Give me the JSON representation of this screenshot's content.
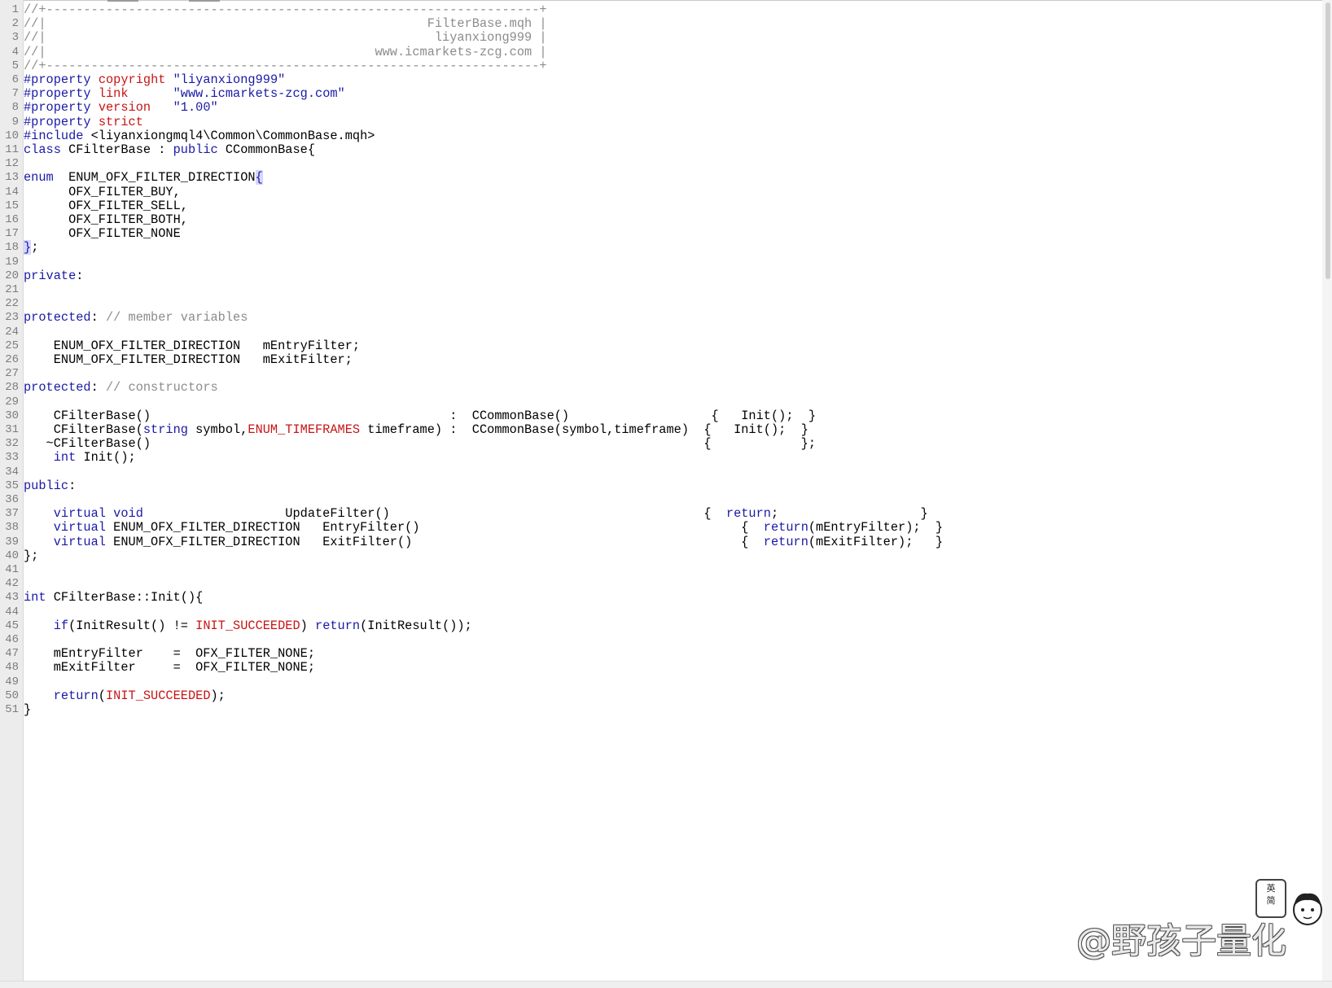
{
  "editor": {
    "lines": [
      "//+------------------------------------------------------------------+",
      "//|                                                   FilterBase.mqh |",
      "//|                                                     liyanxiong999 |",
      "//|                                             www.icmarkets-zcg.com |",
      "//+------------------------------------------------------------------+",
      "#property copyright \"liyanxiong999\"",
      "#property link      \"www.icmarkets-zcg.com\"",
      "#property version   \"1.00\"",
      "#property strict",
      "#include <liyanxiongmql4\\Common\\CommonBase.mqh>",
      "class CFilterBase : public CCommonBase{",
      "",
      "enum  ENUM_OFX_FILTER_DIRECTION{",
      "      OFX_FILTER_BUY,",
      "      OFX_FILTER_SELL,",
      "      OFX_FILTER_BOTH,",
      "      OFX_FILTER_NONE",
      "};",
      "",
      "private:",
      "",
      "",
      "protected: // member variables",
      "",
      "    ENUM_OFX_FILTER_DIRECTION   mEntryFilter;",
      "    ENUM_OFX_FILTER_DIRECTION   mExitFilter;",
      "",
      "protected: // constructors",
      "",
      "    CFilterBase()                                        :  CCommonBase()                   {   Init();  }",
      "    CFilterBase(string symbol,ENUM_TIMEFRAMES timeframe) :  CCommonBase(symbol,timeframe)  {   Init();  }",
      "   ~CFilterBase()                                                                          {            };",
      "    int Init();",
      "",
      "public:",
      "",
      "    virtual void                   UpdateFilter()                                          {  return;                   }",
      "    virtual ENUM_OFX_FILTER_DIRECTION   EntryFilter()                                           {  return(mEntryFilter);  }",
      "    virtual ENUM_OFX_FILTER_DIRECTION   ExitFilter()                                            {  return(mExitFilter);   }",
      "};",
      "",
      "",
      "int CFilterBase::Init(){",
      "",
      "    if(InitResult() != INIT_SUCCEEDED) return(InitResult());",
      "",
      "    mEntryFilter    =  OFX_FILTER_NONE;",
      "    mExitFilter     =  OFX_FILTER_NONE;",
      "",
      "    return(INIT_SUCCEEDED);",
      "}"
    ]
  },
  "ime": {
    "line1": "英",
    "line2": "简"
  },
  "watermark": {
    "text": "@野孩子量化"
  }
}
